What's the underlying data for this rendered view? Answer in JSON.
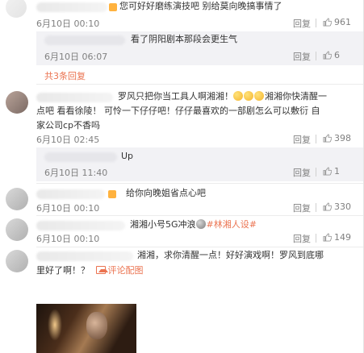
{
  "comments": [
    {
      "text": "您可好好磨练演技吧 别给莫向晚搞事情了",
      "time": "6月10日 00:10",
      "reply_label": "回复",
      "like_count": "961",
      "replies": [
        {
          "text": "看了阴阳剧本那段会更生气",
          "time": "6月10日 06:07",
          "reply_label": "回复",
          "like_count": "6"
        }
      ],
      "more_replies": "共3条回复"
    },
    {
      "text_line1": "罗风只把你当工具人啊湘湘！",
      "text_line1b": "湘湘你快清醒一",
      "text_line2": "点吧 看看徐陵！ 可怜一下仔仔吧！仔仔最喜欢的一部剧怎么可以敷衍 自",
      "text_line3": "家公司cp不香吗",
      "time": "6月10日 02:45",
      "reply_label": "回复",
      "like_count": "398",
      "replies": [
        {
          "text": "Up",
          "time": "6月10日 11:40",
          "reply_label": "回复",
          "like_count": "1"
        }
      ]
    },
    {
      "text": "给你向晚姐省点心吧",
      "time": "6月10日 00:10",
      "reply_label": "回复",
      "like_count": "330"
    },
    {
      "text": "湘湘小号5G冲浪",
      "hashtag": "#林湘人设#",
      "time": "6月10日 00:10",
      "reply_label": "回复",
      "like_count": "149"
    },
    {
      "text_line1": "湘湘，求你清醒一点！好好演戏啊！罗风到底哪",
      "text_line2": "里好了啊！？",
      "image_link": "评论配图"
    }
  ],
  "colors": {
    "link": "#eb7350",
    "muted": "#808080",
    "sub_bg": "#f2f2f5"
  },
  "icons": [
    "thumb-up-icon",
    "image-icon",
    "emoji-icon",
    "vip-badge-icon"
  ]
}
